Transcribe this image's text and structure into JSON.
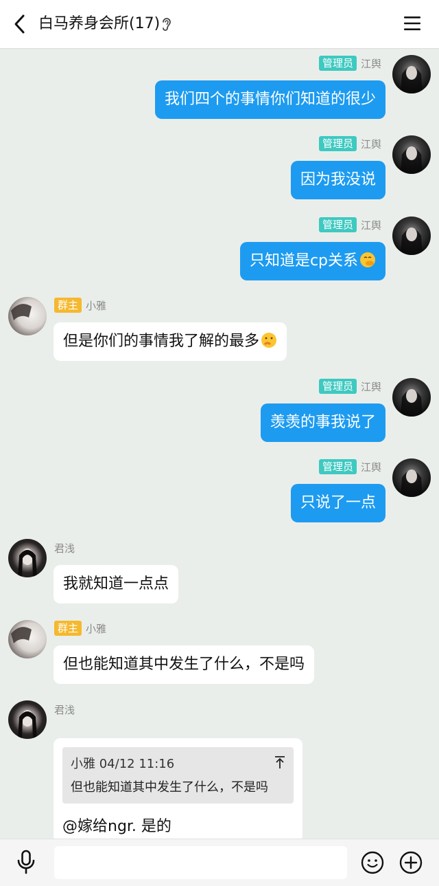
{
  "header": {
    "title": "白马养身会所(17)"
  },
  "messages": [
    {
      "id": "m1",
      "direction": "out",
      "badge": "管理员",
      "sender": "江舆",
      "text": "我们四个的事情你们知道的很少"
    },
    {
      "id": "m2",
      "direction": "out",
      "badge": "管理员",
      "sender": "江舆",
      "text": "因为我没说"
    },
    {
      "id": "m3",
      "direction": "out",
      "badge": "管理员",
      "sender": "江舆",
      "text": "只知道是cp关系",
      "emoji": "face-hand-over-mouth-emoji"
    },
    {
      "id": "m4",
      "direction": "in",
      "badge": "群主",
      "sender": "小雅",
      "text": "但是你们的事情我了解的最多",
      "emoji": "thinking-face-emoji"
    },
    {
      "id": "m5",
      "direction": "out",
      "badge": "管理员",
      "sender": "江舆",
      "text": "羡羡的事我说了"
    },
    {
      "id": "m6",
      "direction": "out",
      "badge": "管理员",
      "sender": "江舆",
      "text": "只说了一点"
    },
    {
      "id": "m7",
      "direction": "in",
      "badge": "",
      "sender": "君浅",
      "text": "我就知道一点点"
    },
    {
      "id": "m8",
      "direction": "in",
      "badge": "群主",
      "sender": "小雅",
      "text": "但也能知道其中发生了什么，不是吗"
    },
    {
      "id": "m9",
      "direction": "in",
      "badge": "",
      "sender": "君浅",
      "quote": {
        "header": "小雅 04/12 11:16",
        "text": "但也能知道其中发生了什么，不是吗"
      },
      "text": "@嫁给ngr. 是的"
    }
  ],
  "colors": {
    "outgoing_bubble": "#1d9bf0",
    "admin_badge": "#3ec9c1",
    "owner_badge": "#f5b82e",
    "background": "#eaeeea"
  },
  "icons": [
    "back-icon",
    "ear-icon",
    "menu-icon",
    "mic-icon",
    "smile-icon",
    "plus-icon",
    "quote-arrow-icon"
  ]
}
